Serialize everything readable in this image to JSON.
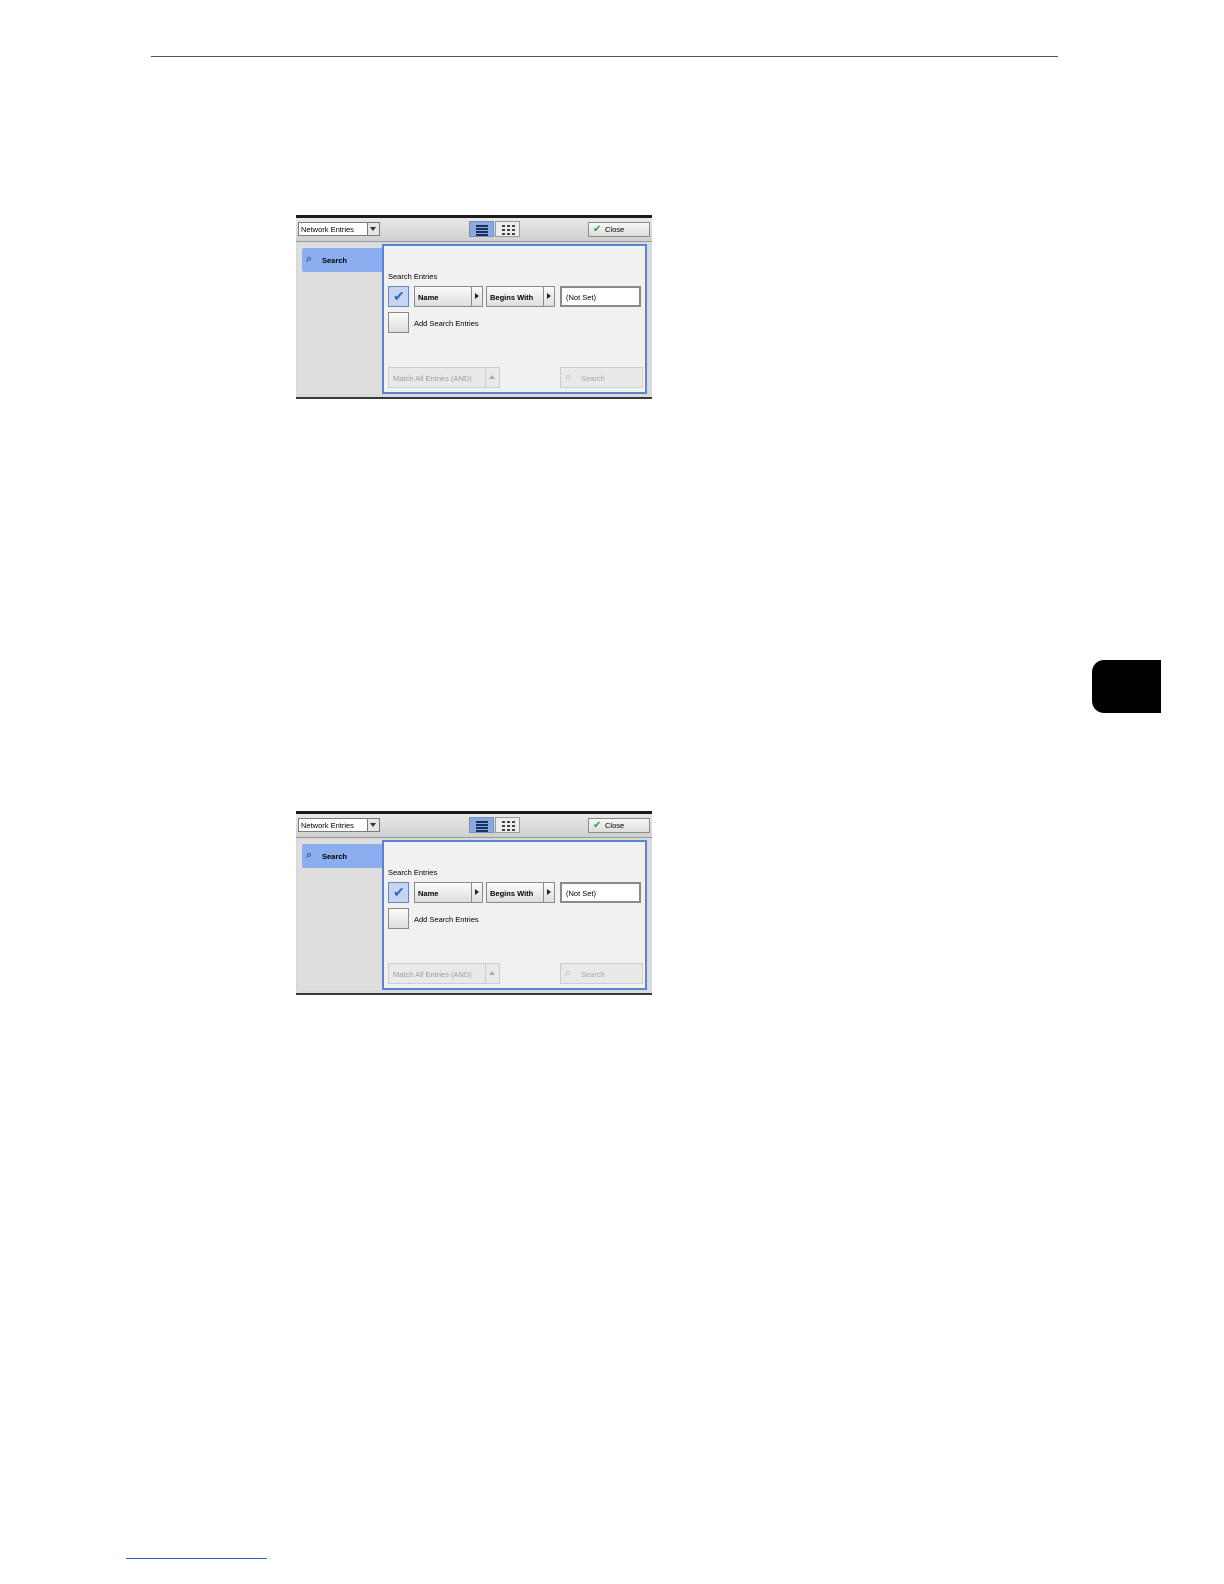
{
  "screens": [
    {
      "address_type": "Network Entries",
      "close_label": "Close",
      "side_tab_label": "Search",
      "section_label": "Search Entries",
      "field_select": "Name",
      "condition_select": "Begins With",
      "search_value": "(Not Set)",
      "add_entries_label": "Add Search Entries",
      "match_mode": "Match All Entries (AND)",
      "search_button": "Search"
    },
    {
      "address_type": "Network Entries",
      "close_label": "Close",
      "side_tab_label": "Search",
      "section_label": "Search Entries",
      "field_select": "Name",
      "condition_select": "Begins With",
      "search_value": "(Not Set)",
      "add_entries_label": "Add Search Entries",
      "match_mode": "Match All Entries (AND)",
      "search_button": "Search"
    }
  ],
  "icons": {
    "search": "binoculars-icon",
    "close": "checkmark-icon",
    "list_view": "list-view-icon",
    "grid_view": "grid-view-icon"
  },
  "colors": {
    "accent_blue": "#8aaef0",
    "panel_border": "#5b84d5",
    "close_check": "#1ca93a",
    "chapter_tab": "#000000"
  }
}
